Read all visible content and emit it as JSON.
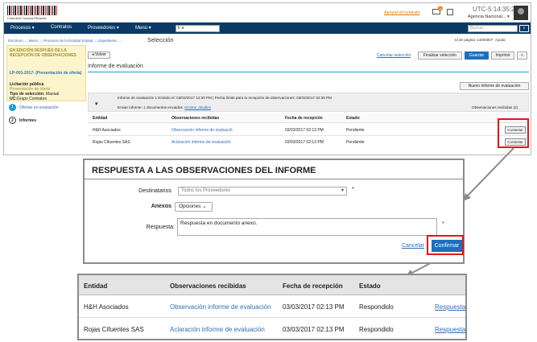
{
  "header": {
    "logo_text": "Colombia Compra Eficiente",
    "top_link": "Apoyar el contrato",
    "mail_badge": "18",
    "time": "UTC-5:14:35:28",
    "agency": "Agencia Nacional..."
  },
  "nav": {
    "items": [
      "Procesos",
      "Contratos",
      "Proveedores",
      "Menú"
    ],
    "search_value": "Ir a",
    "search_placeholder": "Buscar...",
    "search_button": "Buscar"
  },
  "breadcrumb": {
    "path": "Escritorio → Menú → Procesos de la Entidad Estatal → Expediente →",
    "current": "Selección",
    "page_info": "Id de página: 14004807",
    "help": "Ayuda"
  },
  "left_panel": {
    "status": "EN EDICIÓN DESPUÉS DE LA RECEPCIÓN DE OBSERVACIONES",
    "process_id": "LP-001-2017- (Presentación de oferta)",
    "type": "Licitación pública",
    "phase": "Presentación de oferta",
    "selection_label": "Tipo de selección:",
    "selection_value": "Manual",
    "uc_label": "UC:",
    "uc_value": "Grupo Contratos",
    "steps": [
      {
        "num": "1",
        "label": "Ofertas en evaluación"
      },
      {
        "num": "2",
        "label": "Informes"
      }
    ]
  },
  "main": {
    "back_button": "Volver",
    "cancel_selection": "Cancelar selección",
    "finish_selection": "Finalizar selección",
    "save": "Guardar",
    "print": "Imprimir",
    "section_title": "Informe de evaluación",
    "new_report": "Nuevo informe de evaluación",
    "report_line": "Informe de evaluación 1  Emitido el: 03/03/2017 12:30 PM  |  Fecha límite para la recepción de observaciones: 03/03/2017 02:35 PM",
    "sent_line": "Enviar informe: 1 documentos enviados",
    "show_details": "Mostrar detalles",
    "observations_count": "Observaciones recibidas (2)",
    "columns": [
      "Entidad",
      "Observaciones recibidas",
      "Fecha de recepción",
      "Estado"
    ],
    "rows": [
      {
        "entity": "H&H Asociados",
        "observation": "Observación informe de evaluació",
        "date": "03/03/2017 02:13 PM",
        "status": "Pendiente",
        "action": "Contestar"
      },
      {
        "entity": "Rojas Cifuentes SAS",
        "observation": "Aclaración informe de evaluación",
        "date": "03/03/2017 02:13 PM",
        "status": "Pendiente",
        "action": "Contestar"
      }
    ]
  },
  "dialog": {
    "title": "RESPUESTA A LAS OBSERVACIONES DEL INFORME",
    "recipients_label": "Destinatarios",
    "recipients_value": "Todos los Proveedores",
    "attachments_label": "Anexos",
    "options_button": "Opciones",
    "response_label": "Respuesta:",
    "response_value": "Respuesta en documento anexo.",
    "required_mark": "*",
    "cancel": "Cancelar",
    "confirm": "Confirmar"
  },
  "result": {
    "columns": [
      "Entidad",
      "Observaciones recibidas",
      "Fecha de recepción",
      "Estado"
    ],
    "rows": [
      {
        "entity": "H&H Asociados",
        "observation": "Observación informe de evaluación",
        "date": "03/03/2017 02:13 PM",
        "status": "Respondido",
        "action": "Respuesta"
      },
      {
        "entity": "Rojas Cifuentes SAS",
        "observation": "Aclaración informe de evaluación",
        "date": "03/03/2017 02:13 PM",
        "status": "Respondido",
        "action": "Respuesta"
      }
    ]
  },
  "colors": {
    "nav": "#0b3a66",
    "highlight": "#e0151c",
    "primary": "#1d6fbd",
    "link": "#2f6fb3",
    "panel": "#fbf4cc"
  }
}
